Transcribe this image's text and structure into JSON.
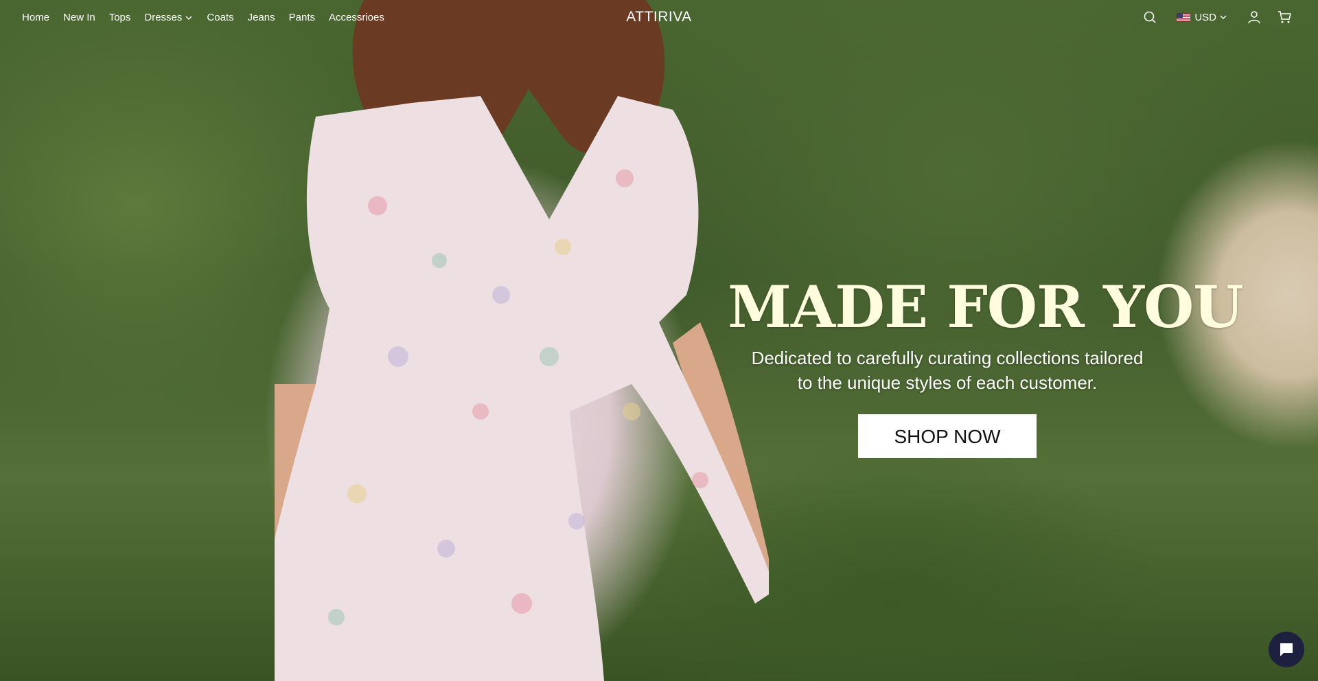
{
  "header": {
    "nav": [
      {
        "label": "Home"
      },
      {
        "label": "New In"
      },
      {
        "label": "Tops"
      },
      {
        "label": "Dresses"
      },
      {
        "label": "Coats"
      },
      {
        "label": "Jeans"
      },
      {
        "label": "Pants"
      },
      {
        "label": "Accessrioes"
      }
    ],
    "logo": "ATTIRIVA",
    "currency": "USD",
    "icons": {
      "search": "search-icon",
      "flag": "us-flag-icon",
      "account": "user-icon",
      "cart": "cart-icon",
      "dropdown": "chevron-down-icon"
    }
  },
  "hero": {
    "headline": "MADE FOR YOU",
    "subtitle": "Dedicated to carefully curating collections tailored to the unique styles of each customer.",
    "cta": "SHOP NOW"
  },
  "chat": {
    "icon": "chat-icon"
  },
  "colors": {
    "headline": "#fffdde",
    "button_bg": "#ffffff",
    "button_text": "#111111",
    "chat_bg": "#1e2040"
  }
}
